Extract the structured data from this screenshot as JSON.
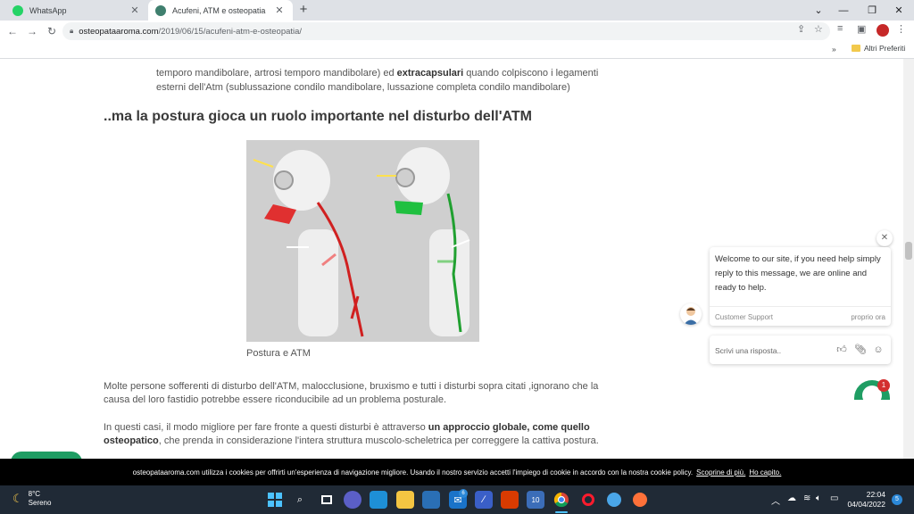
{
  "browser": {
    "tabs": [
      {
        "label": "WhatsApp",
        "close": "✕"
      },
      {
        "label": "Acufeni, ATM e osteopatia",
        "close": "✕"
      }
    ],
    "new_tab": "+",
    "url_host": "osteopataaroma.com",
    "url_path": "/2019/06/15/acufeni-atm-e-osteopatia/",
    "bookmarks_more": "»",
    "bookmarks_folder": "Altri Preferiti"
  },
  "article": {
    "intro_line1": "temporo mandibolare, artrosi temporo mandibolare) ed ",
    "intro_bold": "extracapsulari",
    "intro_line1_rest": " quando colpiscono i legamenti",
    "intro_line2": "esterni dell'Atm (sublussazione condilo mandibolare, lussazione completa condilo mandibolare)",
    "heading": "..ma la postura gioca un ruolo importante nel disturbo dell'ATM",
    "caption": "Postura e ATM",
    "para1": "Molte persone sofferenti di disturbo dell'ATM, malocclusione, bruxismo e tutti i disturbi sopra citati ,ignorano che la causa del loro fastidio potrebbe essere riconducibile ad un problema posturale.",
    "para2_a": "In questi casi, il modo migliore per fare fronte a questi disturbi è attraverso ",
    "para2_bold": "un approccio globale, come quello osteopatico",
    "para2_b": ", che prenda in considerazione l'intera struttura muscolo-scheletrica per correggere la cattiva postura."
  },
  "chat": {
    "close": "✕",
    "message": "Welcome to our site, if you need help simply reply to this message, we are online and ready to help.",
    "agent": "Customer Support",
    "time": "proprio ora",
    "reply_placeholder": "Scrivi una risposta..",
    "badge": "1"
  },
  "cookie": {
    "text": "osteopataaroma.com utilizza i cookies per offrirti un'esperienza di navigazione migliore. Usando il nostro servizio accetti l'impiego di cookie in accordo con la nostra cookie policy.",
    "more": "Scoprine di più.",
    "ok": "Ho capito."
  },
  "taskbar": {
    "temp": "8°C",
    "condition": "Sereno",
    "time": "22:04",
    "date": "04/04/2022",
    "notifications": "5",
    "mail_badge": "6",
    "calendar_day": "10"
  },
  "colors": {
    "whatsapp": "#25d366",
    "accent_green": "#1f9d63",
    "taskbar": "#202a36"
  }
}
